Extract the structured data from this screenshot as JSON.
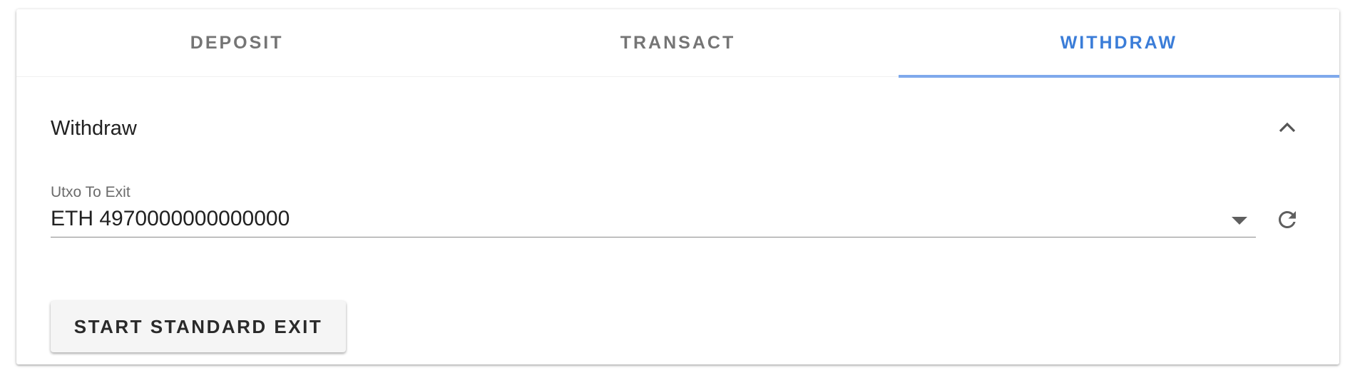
{
  "tabs": [
    {
      "label": "DEPOSIT",
      "active": false
    },
    {
      "label": "TRANSACT",
      "active": false
    },
    {
      "label": "WITHDRAW",
      "active": true
    }
  ],
  "colors": {
    "active_tab": "#3b7dd8",
    "active_indicator": "#7fa9ec",
    "inactive_tab": "#757575"
  },
  "panel": {
    "title": "Withdraw",
    "collapse_icon": "chevron-up-icon",
    "utxo_field": {
      "label": "Utxo To Exit",
      "value": "ETH 4970000000000000",
      "dropdown_icon": "dropdown-arrow-icon"
    },
    "refresh_icon": "refresh-icon",
    "exit_button_label": "START STANDARD EXIT"
  }
}
